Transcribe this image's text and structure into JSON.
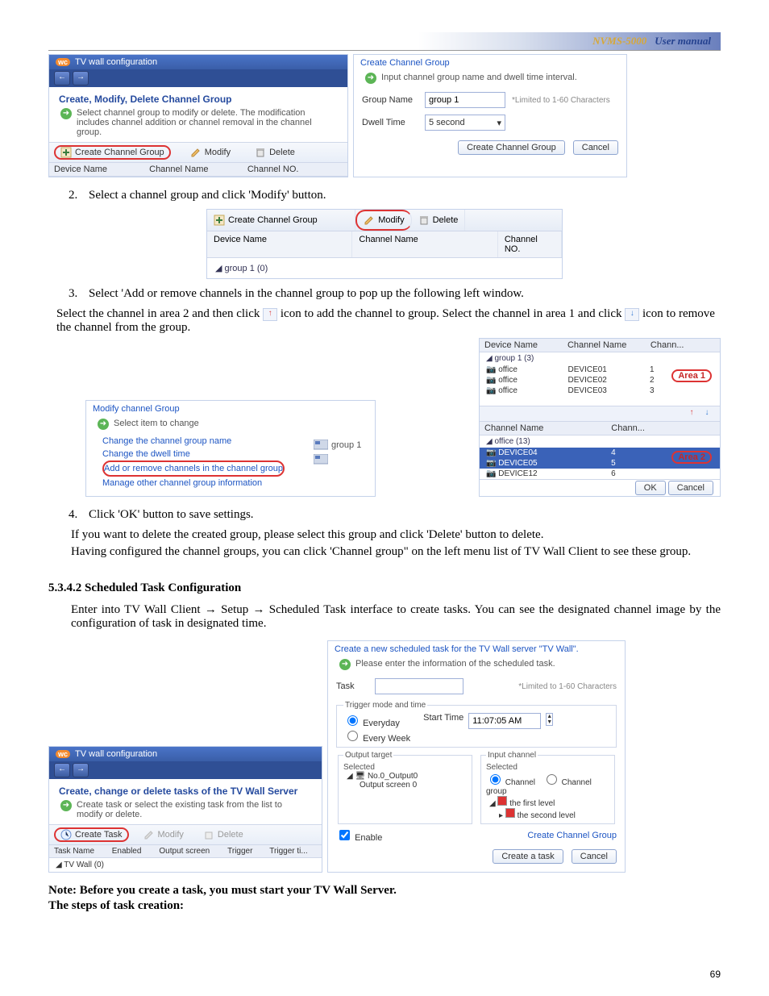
{
  "header": {
    "product": "NVMS-5000",
    "label": "User manual"
  },
  "panelA": {
    "title": "TV wall configuration",
    "section": "Create, Modify, Delete Channel Group",
    "hint": "Select channel group to modify or delete. The modification includes channel addition or channel removal in the channel group.",
    "create": "Create Channel Group",
    "modify": "Modify",
    "delete": "Delete",
    "cols": {
      "device": "Device Name",
      "channel": "Channel Name",
      "no": "Channel NO."
    }
  },
  "panelB": {
    "title": "Create Channel Group",
    "hint": "Input channel group name and dwell time interval.",
    "groupNameLbl": "Group Name",
    "groupNameVal": "group 1",
    "limit": "*Limited to 1-60 Characters",
    "dwellLbl": "Dwell Time",
    "dwellVal": "5 second",
    "createBtn": "Create Channel Group",
    "cancelBtn": "Cancel"
  },
  "step2": "Select a channel group and click 'Modify' button.",
  "tbl2": {
    "create": "Create Channel Group",
    "modify": "Modify",
    "delete": "Delete",
    "cols": {
      "device": "Device Name",
      "channel": "Channel Name",
      "no": "Channel NO."
    },
    "row": "group 1 (0)"
  },
  "step3": "Select 'Add or remove channels in the channel group to pop up the following left window.",
  "step3b_pre": "Select the channel in area 2 and then click ",
  "step3b_mid": " icon to add the channel to group. Select the channel in area 1 and click ",
  "step3b_end": " icon to remove the channel from the group.",
  "panelC": {
    "title": "Modify channel Group",
    "hdr": "Select item to change",
    "opt1": "Change the channel group name",
    "opt2": "Change the dwell time",
    "opt3": "Add or remove channels in the channel group",
    "opt4": "Manage other channel group information",
    "tag": "group 1"
  },
  "panelD": {
    "hdr": {
      "dev": "Device Name",
      "ch": "Channel Name",
      "no": "Chann..."
    },
    "grp": "group 1 (3)",
    "rows": [
      {
        "d": "office",
        "c": "DEVICE01",
        "n": "1"
      },
      {
        "d": "office",
        "c": "DEVICE02",
        "n": "2"
      },
      {
        "d": "office",
        "c": "DEVICE03",
        "n": "3"
      }
    ],
    "area1": "Area 1",
    "hdr2": {
      "ch": "Channel Name",
      "no": "Chann..."
    },
    "grp2": "office (13)",
    "rows2": [
      {
        "c": "DEVICE04",
        "n": "4"
      },
      {
        "c": "DEVICE05",
        "n": "5"
      },
      {
        "c": "DEVICE12",
        "n": "6"
      }
    ],
    "area2": "Area 2",
    "ok": "OK",
    "cancel": "Cancel"
  },
  "step4": "Click 'OK' button to save settings.",
  "after4a": "If you want to delete the created group, please select this group and click 'Delete' button to delete.",
  "after4b": "Having configured the channel groups, you can click 'Channel group\" on the left menu list of TV Wall Client to see these group.",
  "subsec": {
    "no": "5.3.4.2",
    "title": "Scheduled Task Configuration"
  },
  "subsec_p": "Enter into TV Wall Client → Setup → Scheduled Task interface to create tasks. You can see the designated channel image by the configuration of task in designated time.",
  "panelE": {
    "title": "TV wall configuration",
    "section": "Create, change or delete tasks of the TV Wall Server",
    "hint": "Create task or select the existing task from the list to modify or delete.",
    "create": "Create Task",
    "modify": "Modify",
    "delete": "Delete",
    "cols": {
      "name": "Task Name",
      "enabled": "Enabled",
      "out": "Output screen",
      "trig": "Trigger",
      "trigt": "Trigger ti..."
    },
    "row": "TV Wall (0)"
  },
  "panelF": {
    "title": "Create a new scheduled task for the TV Wall server \"TV Wall\".",
    "hint": "Please enter the information of the scheduled task.",
    "taskLbl": "Task",
    "limit": "*Limited to 1-60 Characters",
    "trigHdr": "Trigger mode and time",
    "everyday": "Everyday",
    "everyweek": "Every Week",
    "startLbl": "Start Time",
    "startVal": "11:07:05 AM",
    "outHdr": "Output target",
    "selected": "Selected",
    "outItem1": "No.0_Output0",
    "outItem2": "Output screen 0",
    "inHdr": "Input channel",
    "chOpt": "Channel",
    "cgOpt": "Channel group",
    "lvl1": "the first level",
    "lvl2": "the second level",
    "enable": "Enable",
    "createCG": "Create Channel Group",
    "createBtn": "Create a task",
    "cancelBtn": "Cancel"
  },
  "note1": "Note: Before you create a task, you must start your TV Wall Server.",
  "note2": "The steps of task creation:",
  "pageNo": "69"
}
